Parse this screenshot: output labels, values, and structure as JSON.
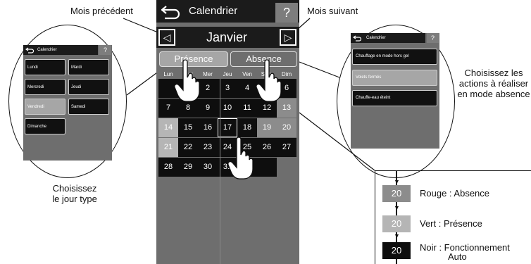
{
  "callouts": {
    "prev_month": "Mois précédent",
    "next_month": "Mois suivant",
    "choose_day_type": [
      "Choisissez",
      "le jour type"
    ],
    "choose_actions": [
      "Choisissez les",
      "actions à réaliser",
      "en mode absence"
    ]
  },
  "phone": {
    "back_icon": "back-arrow-icon",
    "title": "Calendrier",
    "help": "?",
    "prev": "◁",
    "next": "▷",
    "month": "Janvier",
    "presence": "Présence",
    "absence": "Absence",
    "weekdays": [
      "Lun",
      "Mar",
      "Mer",
      "Jeu",
      "Ven",
      "Sam",
      "Dim"
    ],
    "weeks": [
      [
        "",
        "",
        "2",
        "3",
        "4",
        "5",
        "6"
      ],
      [
        "7",
        "8",
        "9",
        "10",
        "11",
        "12",
        "13"
      ],
      [
        "14",
        "15",
        "16",
        "17",
        "18",
        "19",
        "20"
      ],
      [
        "21",
        "22",
        "23",
        "24",
        "25",
        "26",
        "27"
      ],
      [
        "28",
        "29",
        "30",
        "31",
        "",
        "",
        ""
      ]
    ]
  },
  "day_type_panel": {
    "title": "Calendrier",
    "help": "?",
    "days": [
      "Lundi",
      "Mardi",
      "Mercredi",
      "Jeudi",
      "Vendredi",
      "Samedi",
      "Dimanche"
    ],
    "selected": "Vendredi"
  },
  "absence_panel": {
    "title": "Calendrier",
    "help": "?",
    "actions": [
      "Chauffage en mode hors gel",
      "Volets fermés",
      "Chauffe-eau éteint"
    ],
    "selected": "Volets fermés"
  },
  "legend": {
    "items": [
      {
        "value": "20",
        "text": "Rouge : Absence",
        "color": "#8c8c8c"
      },
      {
        "value": "20",
        "text": "Vert : Présence",
        "color": "#b5b5b5"
      },
      {
        "value": "20",
        "text": "Noir : Fonctionnement",
        "text2": "Auto",
        "color": "#0e0e0e"
      }
    ]
  },
  "colors": {
    "dark": "#1b1b1b",
    "panel": "#6e6e6e",
    "absence": "#8c8c8c",
    "presence": "#b5b5b5",
    "auto": "#0e0e0e"
  }
}
